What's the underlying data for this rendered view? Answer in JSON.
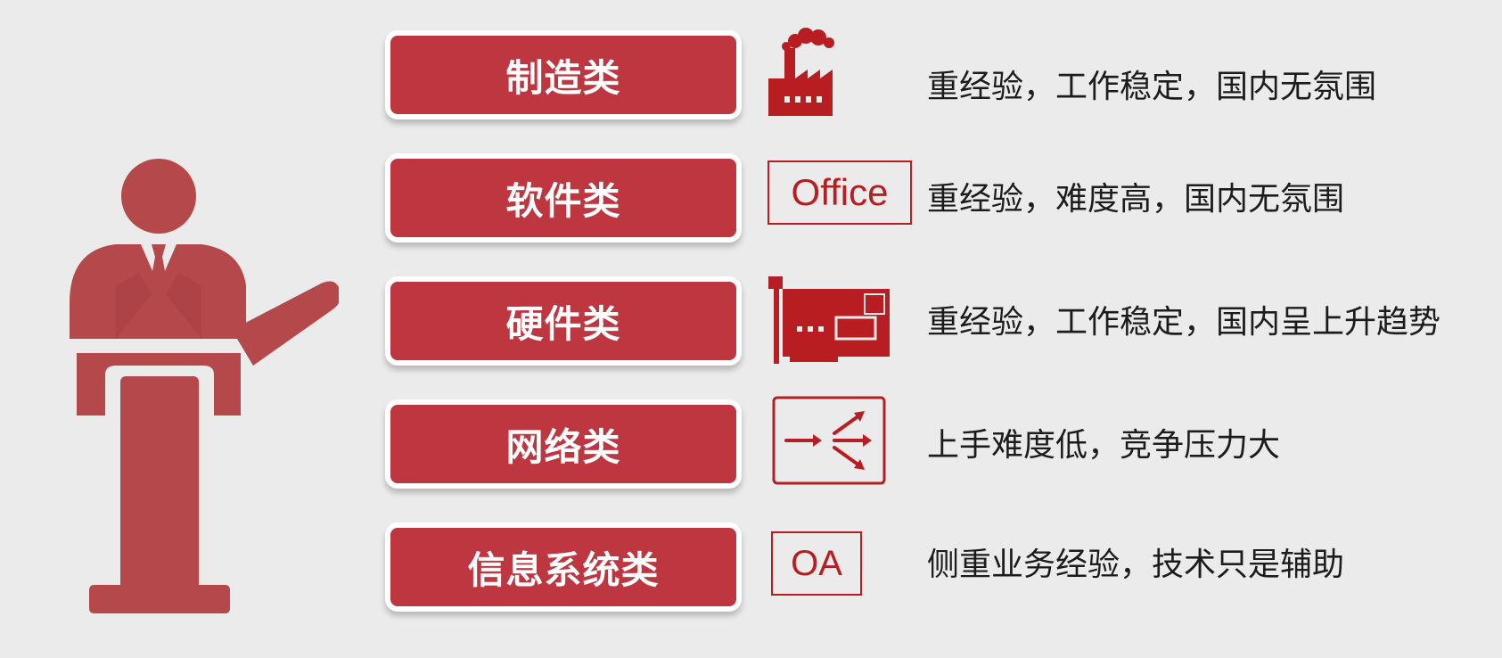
{
  "colors": {
    "background": "#ecebeb",
    "pill": "#bd3640",
    "speaker": "#b4484a",
    "icon_red": "#b81d22",
    "text": "#1c1c1c"
  },
  "rows": [
    {
      "category": "制造类",
      "icon": "factory-icon",
      "description": "重经验，工作稳定，国内无氛围"
    },
    {
      "category": "软件类",
      "icon": "office-label-icon",
      "icon_text": "Office",
      "description": "重经验，难度高，国内无氛围"
    },
    {
      "category": "硬件类",
      "icon": "expansion-card-icon",
      "description": "重经验，工作稳定，国内呈上升趋势"
    },
    {
      "category": "网络类",
      "icon": "network-switch-icon",
      "description": "上手难度低，竞争压力大"
    },
    {
      "category": "信息系统类",
      "icon": "oa-label-icon",
      "icon_text": "OA",
      "description": "侧重业务经验，技术只是辅助"
    }
  ]
}
